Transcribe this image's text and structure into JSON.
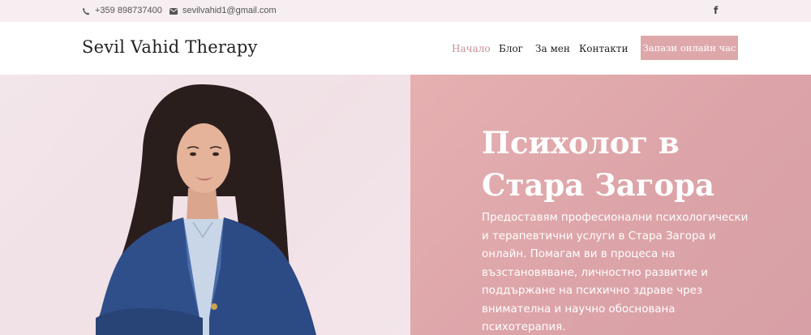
{
  "topbar": {
    "phone_icon": "phone-icon",
    "phone": "+359 898737400",
    "email_icon": "envelope-icon",
    "email": "sevilvahid1@gmail.com",
    "social_icon": "facebook-icon",
    "social_glyph": "f"
  },
  "header": {
    "logo": "Sevil Vahid Therapy",
    "nav": {
      "home": "Начало",
      "blog": "Блог",
      "about": "За мен",
      "contacts": "Контакти"
    },
    "cta": "Запази онлайн час"
  },
  "hero": {
    "title": "Психолог в Стара Загора",
    "text": "Предоставям професионални психологически и терапевтични услуги в Стара Загора и онлайн. Помагам ви в процеса на възстановяване, личностно развитие и поддържане на психично здраве чрез внимателна и научно обоснована психотерапия."
  },
  "colors": {
    "accent": "#dea8ab",
    "active_nav": "#c48f95",
    "topbar_bg": "#f6eef0",
    "hero_right_bg": "#dca4a8"
  }
}
